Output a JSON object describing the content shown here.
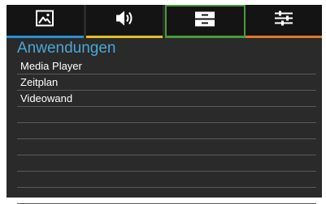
{
  "tabs": [
    {
      "icon": "picture-icon",
      "underline_color": "#2a8fd0",
      "active": false
    },
    {
      "icon": "speaker-icon",
      "underline_color": "#e0c02a",
      "active": false
    },
    {
      "icon": "app-drawer-icon",
      "underline_color": "#4a9a3a",
      "active": true
    },
    {
      "icon": "sliders-icon",
      "underline_color": "#e0782a",
      "active": false
    }
  ],
  "section": {
    "title": "Anwendungen",
    "title_color": "#4aa7d8"
  },
  "list": {
    "items": [
      "Media Player",
      "Zeitplan",
      "Videowand"
    ],
    "empty_rows": 6
  }
}
